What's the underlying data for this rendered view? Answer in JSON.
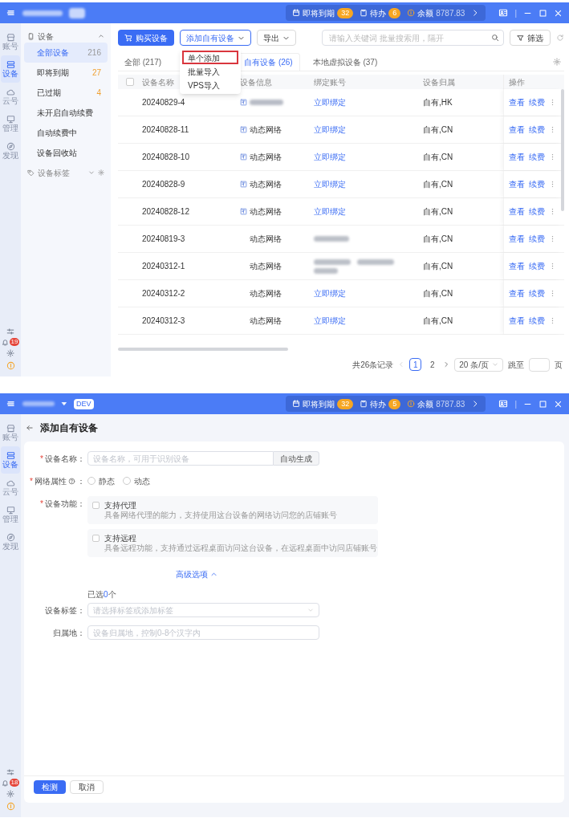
{
  "device_list_window": {
    "title_bar": {
      "status": [
        {
          "kind": "badge",
          "label": "即将到期",
          "count": "32"
        },
        {
          "kind": "badge",
          "label": "待办",
          "count": "6"
        },
        {
          "kind": "amount",
          "label": "余额",
          "count": "8787.83"
        }
      ],
      "divider": "|"
    },
    "rail": {
      "items": [
        {
          "label": "账号",
          "selected": false
        },
        {
          "label": "设备",
          "selected": true
        },
        {
          "label": "云号",
          "selected": false
        },
        {
          "label": "管理",
          "selected": false
        },
        {
          "label": "发现",
          "selected": false
        }
      ],
      "notification_count": "19"
    },
    "sidebar": {
      "group": {
        "label": "设备",
        "expanded": true
      },
      "items": [
        {
          "label": "全部设备",
          "count": "216",
          "warning": false,
          "selected": true
        },
        {
          "label": "即将到期",
          "count": "27",
          "warning": true,
          "selected": false
        },
        {
          "label": "已过期",
          "count": "4",
          "warning": true,
          "selected": false
        },
        {
          "label": "未开启自动续费",
          "selected": false
        },
        {
          "label": "自动续费中",
          "selected": false
        },
        {
          "label": "设备回收站",
          "selected": false
        }
      ],
      "tags_group": {
        "label": "设备标签",
        "expanded": false
      }
    },
    "toolbar": {
      "buy_button": "购买设备",
      "add_dropdown": {
        "label": "添加自有设备",
        "expanded": true,
        "menu": [
          {
            "label": "单个添加",
            "highlighted": true
          },
          {
            "label": "批量导入",
            "highlighted": false
          },
          {
            "label": "VPS导入",
            "highlighted": false
          }
        ]
      },
      "export_dropdown": "导出",
      "search": {
        "placeholder": "请输入关键词 批量搜索用，隔开"
      },
      "filter_button": "筛选"
    },
    "tabs": [
      {
        "label": "全部 (217)",
        "selected": false
      },
      {
        "label": "自有设备 (26)",
        "selected": true
      },
      {
        "label": "本地虚拟设备 (37)",
        "selected": false
      }
    ],
    "table": {
      "select_all_checked": false,
      "columns": [
        "设备名称",
        "设备信息",
        "绑定账号",
        "设备归属",
        "操作"
      ],
      "rows": [
        {
          "name": "20240829-4",
          "info": {
            "kind": "redacted",
            "tagged": true
          },
          "account": {
            "kind": "link",
            "text": "立即绑定"
          },
          "owner": "自有,HK",
          "actions": [
            "查看",
            "续费"
          ]
        },
        {
          "name": "20240828-11",
          "info": {
            "kind": "text",
            "text": "动态网络",
            "tagged": true
          },
          "account": {
            "kind": "link",
            "text": "立即绑定"
          },
          "owner": "自有,CN",
          "actions": [
            "查看",
            "续费"
          ]
        },
        {
          "name": "20240828-10",
          "info": {
            "kind": "text",
            "text": "动态网络",
            "tagged": true
          },
          "account": {
            "kind": "link",
            "text": "立即绑定"
          },
          "owner": "自有,CN",
          "actions": [
            "查看",
            "续费"
          ]
        },
        {
          "name": "20240828-9",
          "info": {
            "kind": "text",
            "text": "动态网络",
            "tagged": true
          },
          "account": {
            "kind": "link",
            "text": "立即绑定"
          },
          "owner": "自有,CN",
          "actions": [
            "查看",
            "续费"
          ]
        },
        {
          "name": "20240828-12",
          "info": {
            "kind": "text",
            "text": "动态网络",
            "tagged": true
          },
          "account": {
            "kind": "link",
            "text": "立即绑定"
          },
          "owner": "自有,CN",
          "actions": [
            "查看",
            "续费"
          ]
        },
        {
          "name": "20240819-3",
          "info": {
            "kind": "text",
            "text": "动态网络",
            "tagged": false
          },
          "account": {
            "kind": "redacted"
          },
          "owner": "自有,CN",
          "actions": [
            "查看",
            "续费"
          ]
        },
        {
          "name": "20240312-1",
          "info": {
            "kind": "text",
            "text": "动态网络",
            "tagged": false
          },
          "account": {
            "kind": "redacted_multiline"
          },
          "owner": "自有,CN",
          "actions": [
            "查看",
            "续费"
          ]
        },
        {
          "name": "20240312-2",
          "info": {
            "kind": "text",
            "text": "动态网络",
            "tagged": false
          },
          "account": {
            "kind": "link",
            "text": "立即绑定"
          },
          "owner": "自有,CN",
          "actions": [
            "查看",
            "续费"
          ]
        },
        {
          "name": "20240312-3",
          "info": {
            "kind": "text",
            "text": "动态网络",
            "tagged": false
          },
          "account": {
            "kind": "link",
            "text": "立即绑定"
          },
          "owner": "自有,CN",
          "actions": [
            "查看",
            "续费"
          ]
        }
      ]
    },
    "pagination": {
      "total": "共26条记录",
      "pages": [
        {
          "label": "1",
          "selected": true
        },
        {
          "label": "2",
          "selected": false
        }
      ],
      "page_size": "20 条/页",
      "jump_label": "跳至",
      "page_unit": "页"
    }
  },
  "add_device_window": {
    "title_bar": {
      "env_badge": "DEV",
      "status": [
        {
          "kind": "badge",
          "label": "即将到期",
          "count": "32"
        },
        {
          "kind": "badge",
          "label": "待办",
          "count": "5"
        },
        {
          "kind": "amount",
          "label": "余额",
          "count": "8787.83"
        }
      ],
      "divider": "|"
    },
    "rail": {
      "items": [
        {
          "label": "账号",
          "selected": false
        },
        {
          "label": "设备",
          "selected": true
        },
        {
          "label": "云号",
          "selected": false
        },
        {
          "label": "管理",
          "selected": false
        },
        {
          "label": "发现",
          "selected": false
        }
      ],
      "notification_count": "18"
    },
    "page_title": "添加自有设备",
    "fields": [
      {
        "kind": "text_with_button",
        "required_mark": "*",
        "label": "设备名称：",
        "placeholder": "设备名称，可用于识别设备",
        "button": "自动生成"
      },
      {
        "kind": "radio",
        "required_mark": "*",
        "label": "网络属性",
        "help": true,
        "colon": "：",
        "options": [
          {
            "label": "静态",
            "selected": false
          },
          {
            "label": "动态",
            "selected": false
          }
        ]
      },
      {
        "kind": "checkbox_cards",
        "required_mark": "*",
        "label": "设备功能：",
        "options": [
          {
            "title": "支持代理",
            "description": "具备网络代理的能力，支持使用这台设备的网络访问您的店铺账号",
            "checked": false
          },
          {
            "title": "支持远程",
            "description": "具备远程功能，支持通过远程桌面访问这台设备，在远程桌面中访问店铺账号",
            "checked": false
          }
        ]
      }
    ],
    "advanced_toggle": {
      "label": "高级选项",
      "expanded": true
    },
    "advanced_fields": [
      {
        "kind": "select",
        "label": "设备标签：",
        "hint": {
          "before": "已选",
          "count": "0",
          "after": "个"
        },
        "placeholder": "请选择标签或添加标签"
      },
      {
        "kind": "text",
        "label": "归属地：",
        "placeholder": "设备归属地，控制0-8个汉字内"
      }
    ],
    "actions": [
      {
        "label": "检测",
        "primary": true
      },
      {
        "label": "取消",
        "primary": false
      }
    ]
  }
}
